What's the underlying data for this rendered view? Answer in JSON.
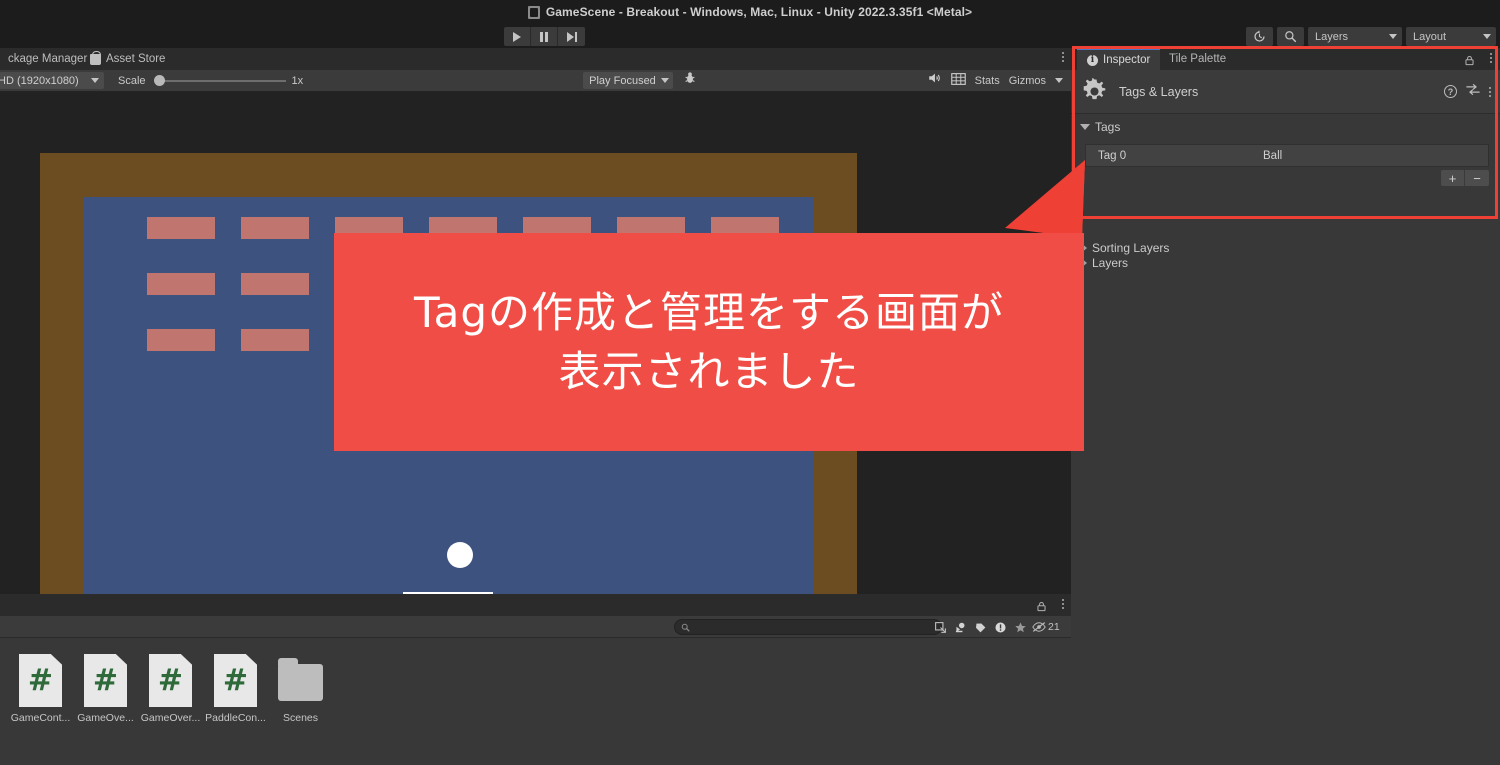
{
  "window": {
    "title": "GameScene - Breakout - Windows, Mac, Linux - Unity 2022.3.35f1 <Metal>",
    "doc_icon": "unity-document-icon"
  },
  "toolbar": {
    "play_label": "play-icon",
    "pause_label": "pause-icon",
    "step_label": "step-icon",
    "history_icon": "history-icon",
    "search_icon": "search-icon",
    "layers_label": "Layers",
    "layout_label": "Layout"
  },
  "game_panel": {
    "tabs": [
      {
        "label": "ckage Manager",
        "icon": "package-icon",
        "active": false
      },
      {
        "label": "Asset Store",
        "icon": "asset-store-icon",
        "active": false
      }
    ],
    "toolbar": {
      "resolution": "HD (1920x1080)",
      "scale_label": "Scale",
      "scale_value": "1x",
      "play_mode": "Play Focused",
      "bug_icon": "bug-icon",
      "mute_icon": "mute-audio-icon",
      "grid_icon": "grid-icon",
      "stats_label": "Stats",
      "gizmos_label": "Gizmos"
    },
    "game": {
      "field_color": "#3E5280",
      "border_color": "#6B4D21",
      "brick_color": "#C0766E",
      "ball_color": "#FFFFFF",
      "paddle_color": "#FFFFFF",
      "brick_rows": 3,
      "brick_cols": 7
    }
  },
  "project_panel": {
    "search_placeholder": "",
    "search_value": "",
    "hidden_count": "21",
    "filters": [
      "search-by-type-icon",
      "search-by-label-icon",
      "label-icon",
      "warning-icon",
      "favorite-star-icon"
    ],
    "assets": [
      {
        "label": "GameCont...",
        "type": "csharp"
      },
      {
        "label": "GameOve...",
        "type": "csharp"
      },
      {
        "label": "GameOver...",
        "type": "csharp"
      },
      {
        "label": "PaddleCon...",
        "type": "csharp"
      },
      {
        "label": "Scenes",
        "type": "folder"
      }
    ]
  },
  "inspector": {
    "tabs": [
      {
        "label": "Inspector",
        "active": true
      },
      {
        "label": "Tile Palette",
        "active": false
      }
    ],
    "header": {
      "title": "Tags & Layers",
      "gear_icon": "settings-gear-icon",
      "help_icon": "help-icon",
      "preset_icon": "preset-icon",
      "kebab_icon": "more-options-icon"
    },
    "sections": {
      "tags": {
        "label": "Tags",
        "expanded": true,
        "rows": [
          {
            "name": "Tag 0",
            "value": "Ball"
          }
        ],
        "add_label": "+",
        "remove_label": "−"
      },
      "sorting_layers": {
        "label": "Sorting Layers",
        "expanded": false
      },
      "layers": {
        "label": "Layers",
        "expanded": false
      }
    }
  },
  "annotation": {
    "callout_lines": [
      "Tagの作成と管理をする画面が",
      "表示されました"
    ],
    "highlight_color": "#ef4036",
    "callout_color": "#ef4d45"
  }
}
